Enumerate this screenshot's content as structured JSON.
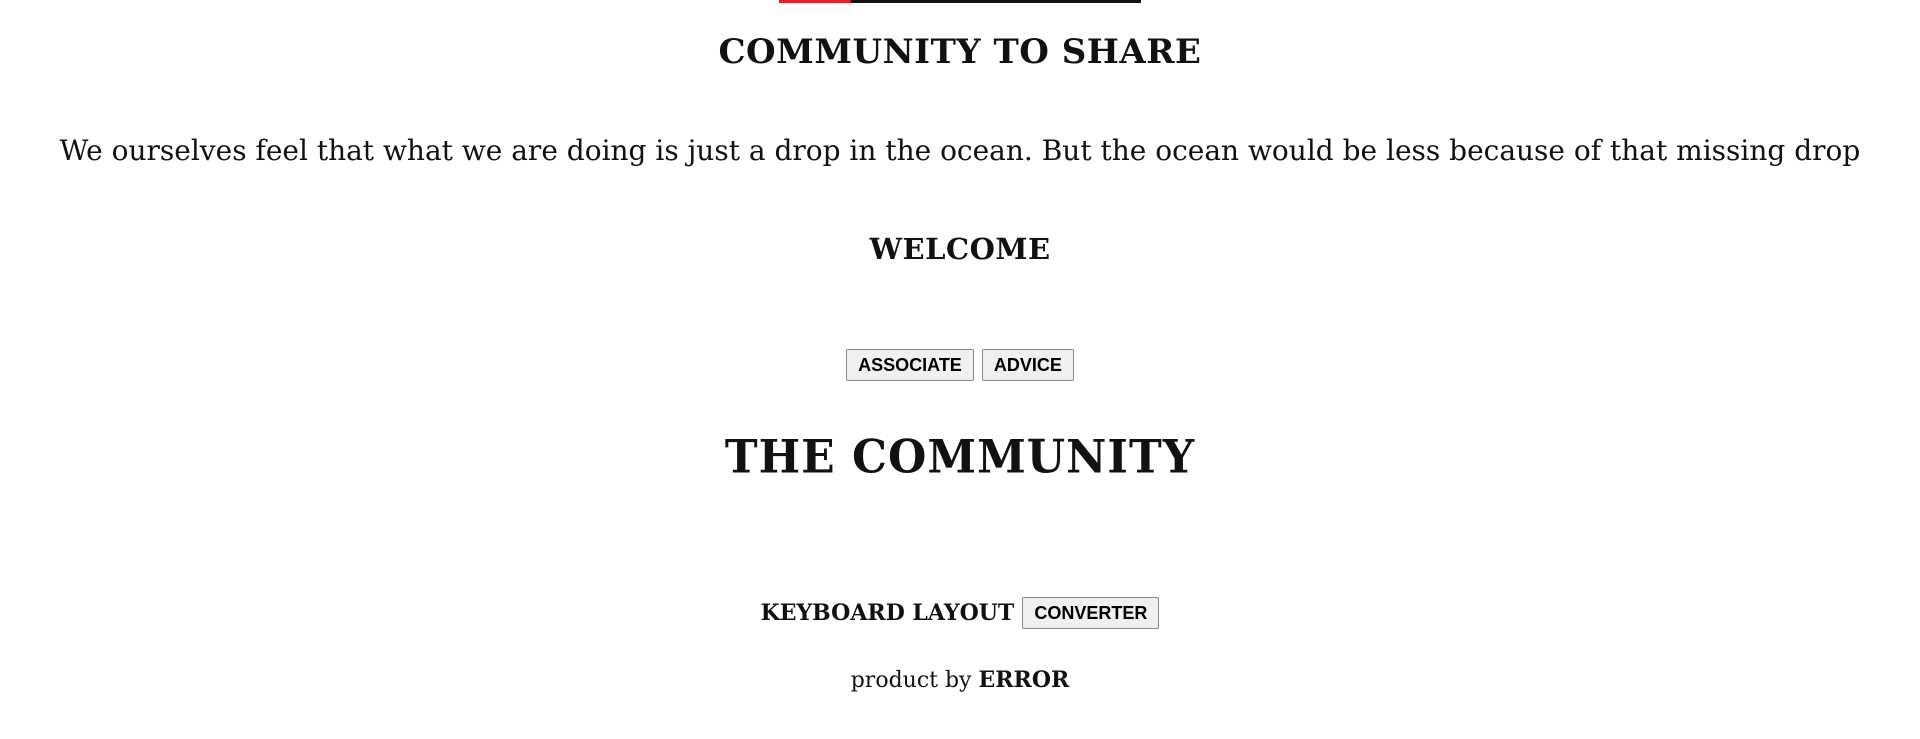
{
  "header": {
    "accent_color": "#e0202a",
    "bar_color": "#111111",
    "accent_fraction": 0.2
  },
  "headline": "COMMUNITY TO SHARE",
  "quote": "We ourselves feel that what we are doing is just a drop in the ocean. But the ocean would be less because of that missing drop",
  "welcome": "WELCOME",
  "buttons": {
    "associate": "ASSOCIATE",
    "advice": "ADVICE"
  },
  "community_title": "THE COMMUNITY",
  "keyboard": {
    "label": "KEYBOARD LAYOUT",
    "converter_button": "CONVERTER"
  },
  "footer": {
    "prefix": "product by",
    "brand": "ERROR"
  }
}
